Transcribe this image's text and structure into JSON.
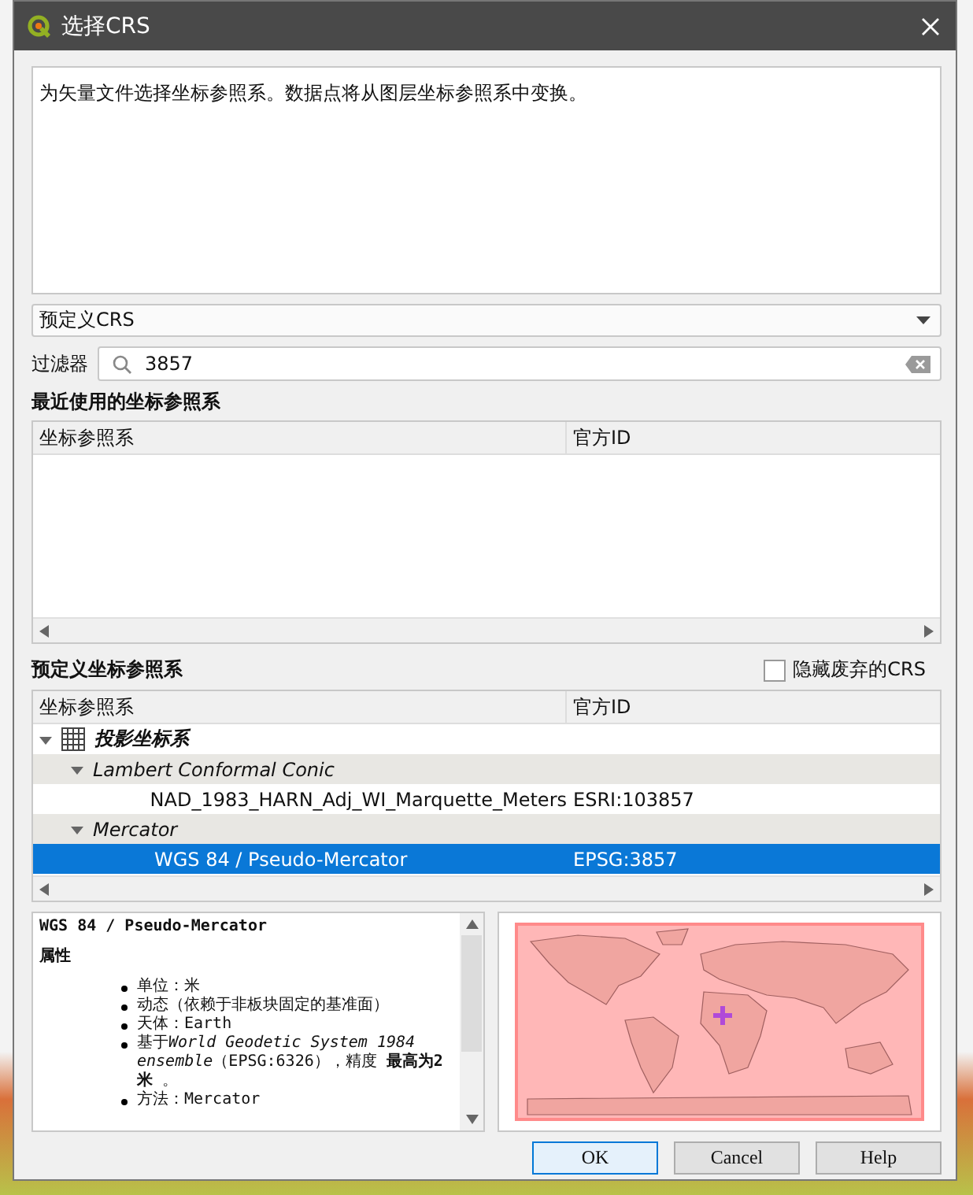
{
  "window": {
    "title": "选择CRS"
  },
  "description": "为矢量文件选择坐标参照系。数据点将从图层坐标参照系中变换。",
  "source_dropdown": {
    "value": "预定义CRS"
  },
  "filter": {
    "label": "过滤器",
    "value": "3857"
  },
  "recent": {
    "title": "最近使用的坐标参照系",
    "columns": [
      "坐标参照系",
      "官方ID"
    ]
  },
  "predefined": {
    "title": "预定义坐标参照系",
    "hide_deprecated": {
      "label": "隐藏废弃的CRS",
      "checked": false
    },
    "columns": [
      "坐标参照系",
      "官方ID"
    ],
    "tree": [
      {
        "kind": "category",
        "name": "投影坐标系",
        "expanded": true,
        "children": [
          {
            "kind": "group",
            "name": "Lambert Conformal Conic",
            "expanded": true,
            "children": [
              {
                "kind": "crs",
                "name": "NAD_1983_HARN_Adj_WI_Marquette_Meters",
                "id": "ESRI:103857",
                "selected": false
              }
            ]
          },
          {
            "kind": "group",
            "name": "Mercator",
            "expanded": true,
            "children": [
              {
                "kind": "crs",
                "name": "WGS 84 / Pseudo-Mercator",
                "id": "EPSG:3857",
                "selected": true
              }
            ]
          }
        ]
      }
    ]
  },
  "details": {
    "title": "WGS 84 / Pseudo-Mercator",
    "heading": "属性",
    "bullets": [
      "单位：米",
      "动态（依赖于非板块固定的基准面）",
      "天体：Earth",
      [
        {
          "text": "基于"
        },
        {
          "text": "World Geodetic System 1984 ensemble",
          "italic": true
        },
        {
          "text": "（EPSG:6326），精度 "
        },
        {
          "text": "最高为2米",
          "bold": true
        },
        {
          "text": " 。"
        }
      ],
      "方法：Mercator"
    ]
  },
  "buttons": [
    "OK",
    "Cancel",
    "Help"
  ]
}
